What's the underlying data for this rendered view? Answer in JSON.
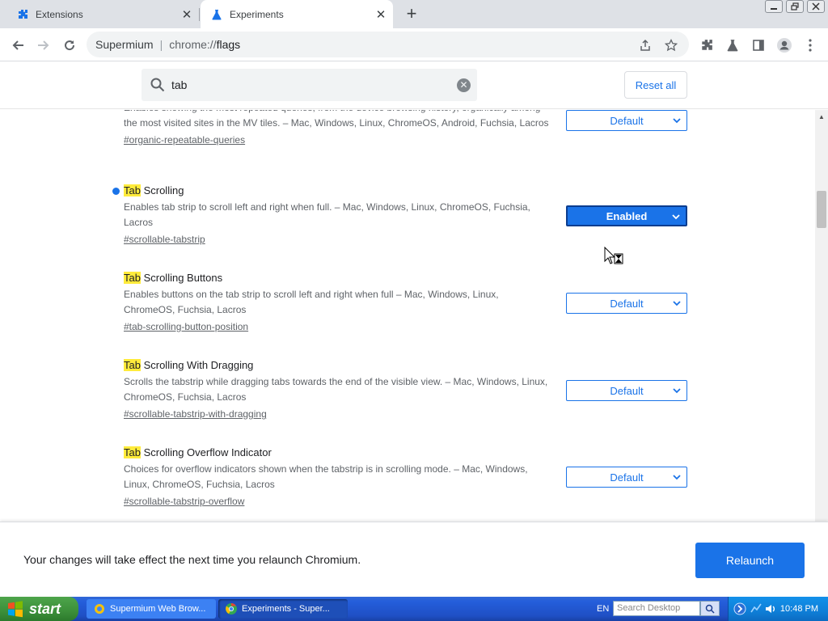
{
  "tabs": [
    {
      "title": "Extensions",
      "icon": "puzzle-icon",
      "active": false
    },
    {
      "title": "Experiments",
      "icon": "flask-icon",
      "active": true
    }
  ],
  "window_controls": [
    "minimize",
    "restore",
    "close"
  ],
  "toolbar": {
    "site_name": "Supermium",
    "url_scheme": "chrome://",
    "url_path": "flags"
  },
  "flags_header": {
    "search_value": "tab",
    "reset_label": "Reset all"
  },
  "flags": [
    {
      "title_highlight": "",
      "title_rest": "",
      "desc": "Enables showing the most repeated queries, from the device browsing history, organically among the most visited sites in the MV tiles. – Mac, Windows, Linux, ChromeOS, Android, Fuchsia, Lacros",
      "link": "#organic-repeatable-queries",
      "value": "Default",
      "modified": false
    },
    {
      "title_highlight": "Tab",
      "title_rest": " Scrolling",
      "desc": "Enables tab strip to scroll left and right when full. – Mac, Windows, Linux, ChromeOS, Fuchsia, Lacros",
      "link": "#scrollable-tabstrip",
      "value": "Enabled",
      "modified": true
    },
    {
      "title_highlight": "Tab",
      "title_rest": " Scrolling Buttons",
      "desc": "Enables buttons on the tab strip to scroll left and right when full – Mac, Windows, Linux, ChromeOS, Fuchsia, Lacros",
      "link": "#tab-scrolling-button-position",
      "value": "Default",
      "modified": false
    },
    {
      "title_highlight": "Tab",
      "title_rest": " Scrolling With Dragging",
      "desc": "Scrolls the tabstrip while dragging tabs towards the end of the visible view. – Mac, Windows, Linux, ChromeOS, Fuchsia, Lacros",
      "link": "#scrollable-tabstrip-with-dragging",
      "value": "Default",
      "modified": false
    },
    {
      "title_highlight": "Tab",
      "title_rest": " Scrolling Overflow Indicator",
      "desc": "Choices for overflow indicators shown when the tabstrip is in scrolling mode. – Mac, Windows, Linux, ChromeOS, Fuchsia, Lacros",
      "link": "#scrollable-tabstrip-overflow",
      "value": "Default",
      "modified": false
    }
  ],
  "relaunch": {
    "message": "Your changes will take effect the next time you relaunch Chromium.",
    "button_label": "Relaunch"
  },
  "taskbar": {
    "start_label": "start",
    "tasks": [
      {
        "title": "Supermium Web Brow...",
        "active": false
      },
      {
        "title": "Experiments - Super...",
        "active": true
      }
    ],
    "language": "EN",
    "search_placeholder": "Search Desktop",
    "clock": "10:48 PM"
  },
  "colors": {
    "accent": "#1a73e8",
    "highlight": "#ffeb3b",
    "taskbar": "#245edb",
    "start_button": "#3c8f3a"
  }
}
